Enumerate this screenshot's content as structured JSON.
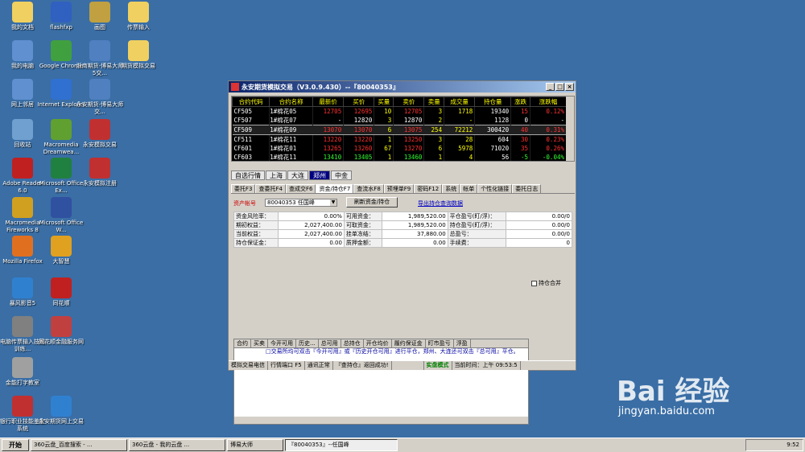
{
  "desktop": {
    "icons": [
      {
        "label": "我的文档",
        "icon": "documents-icon",
        "color": "#f0d060"
      },
      {
        "label": "flashfxp",
        "icon": "flashfxp-icon",
        "color": "#3060c0"
      },
      {
        "label": "画图",
        "icon": "paint-icon",
        "color": "#c0a040"
      },
      {
        "label": "传票输入",
        "icon": "folder-icon",
        "color": "#f0d060"
      },
      {
        "label": "我的电脑",
        "icon": "computer-icon",
        "color": "#6090d0"
      },
      {
        "label": "Google Chrome",
        "icon": "chrome-icon",
        "color": "#40a040"
      },
      {
        "label": "浙商期货-博易大师5交...",
        "icon": "shortcut-icon",
        "color": "#5080c0"
      },
      {
        "label": "期货模拟交易",
        "icon": "folder-icon",
        "color": "#f0d060"
      },
      {
        "label": "网上邻居",
        "icon": "network-icon",
        "color": "#6090d0"
      },
      {
        "label": "Internet Explorer",
        "icon": "ie-icon",
        "color": "#3070d0"
      },
      {
        "label": "永安期货-博易大师交...",
        "icon": "shortcut-icon",
        "color": "#5080c0"
      },
      {
        "label": "回收站",
        "icon": "recycle-bin-icon",
        "color": "#70a0d0"
      },
      {
        "label": "Macromedia Dreamwea...",
        "icon": "dreamweaver-icon",
        "color": "#60a030"
      },
      {
        "label": "永安模拟交易",
        "icon": "trade-icon",
        "color": "#c03030"
      },
      {
        "label": "Adobe Reader 6.0",
        "icon": "adobe-reader-icon",
        "color": "#c02020"
      },
      {
        "label": "Microsoft Office Ex...",
        "icon": "excel-icon",
        "color": "#208040"
      },
      {
        "label": "永安模拟注册",
        "icon": "trade-icon",
        "color": "#c03030"
      },
      {
        "label": "Macromedia Fireworks 8",
        "icon": "fireworks-icon",
        "color": "#d0a020"
      },
      {
        "label": "Microsoft Office W...",
        "icon": "word-icon",
        "color": "#3050a0"
      },
      {
        "label": "Mozilla Firefox",
        "icon": "firefox-icon",
        "color": "#e07020"
      },
      {
        "label": "大智慧",
        "icon": "dzh-icon",
        "color": "#e0a020"
      },
      {
        "label": "暴风影音5",
        "icon": "player-icon",
        "color": "#3080d0"
      },
      {
        "label": "同花顺",
        "icon": "ths-icon",
        "color": "#c02020"
      },
      {
        "label": "电脑传票输入技能训练...",
        "icon": "training-icon",
        "color": "#808080"
      },
      {
        "label": "同花顺金融服务网",
        "icon": "news-icon",
        "color": "#c04040"
      },
      {
        "label": "金能打字教室",
        "icon": "typing-icon",
        "color": "#a0a0a0"
      },
      {
        "label": "银行职业技能鉴定系统",
        "icon": "bank-icon",
        "color": "#c03030"
      },
      {
        "label": "永安期货网上交易",
        "icon": "trade-online-icon",
        "color": "#3080d0"
      }
    ]
  },
  "window": {
    "title": "永安期货模拟交易（V3.0.9.430）--『80040353』",
    "quote_headers": [
      "合约代码",
      "合约名称",
      "最新价",
      "买价",
      "买量",
      "卖价",
      "卖量",
      "成交量",
      "持仓量",
      "涨跌",
      "涨跌幅"
    ],
    "quote_rows": [
      [
        "CF505",
        "1#棉花05",
        "12705",
        "12695",
        "10",
        "12705",
        "3",
        "1718",
        "19340",
        "15",
        "0.12%"
      ],
      [
        "CF507",
        "1#棉花07",
        "-",
        "12820",
        "3",
        "12870",
        "2",
        "-",
        "1128",
        "0",
        "-"
      ],
      [
        "CF509",
        "1#棉花09",
        "13070",
        "13070",
        "6",
        "13075",
        "254",
        "72212",
        "300420",
        "40",
        "0.31%"
      ],
      [
        "CF511",
        "1#棉花11",
        "13220",
        "13220",
        "1",
        "13250",
        "3",
        "28",
        "604",
        "30",
        "0.23%"
      ],
      [
        "CF601",
        "1#棉花01",
        "13265",
        "13260",
        "67",
        "13270",
        "6",
        "5978",
        "71020",
        "35",
        "0.26%"
      ],
      [
        "CF603",
        "1#棉花11",
        "13410",
        "13405",
        "1",
        "13460",
        "1",
        "4",
        "56",
        "-5",
        "-0.04%"
      ]
    ],
    "market_tabs": [
      "自选行情",
      "上海",
      "大连",
      "郑州",
      "中金"
    ],
    "active_market": "郑州",
    "sub_tabs": [
      "委托F3",
      "查委托F4",
      "查成交F6",
      "资金/持仓F7",
      "查流水F8",
      "预埋单F9",
      "密码F12",
      "系统",
      "帐单",
      "个性化链接",
      "委托日志"
    ],
    "active_sub": "资金/持仓F7",
    "account_label": "资产帐号",
    "account_value": "80040353 任国峰",
    "refresh_button": "刷新资金/持仓",
    "export_link": "导出持仓查询数据",
    "fund": [
      [
        "资金风险率：",
        "0.00%",
        "可用资金：",
        "1,989,520.00",
        "平仓盈亏(盯/浮)：",
        "0.00/0"
      ],
      [
        "期初权益：",
        "2,027,400.00",
        "可取资金：",
        "1,989,520.00",
        "持仓盈亏(盯/浮)：",
        "0.00/0"
      ],
      [
        "当前权益：",
        "2,027,400.00",
        "挂单冻结：",
        "37,880.00",
        "总盈亏：",
        "0.00/0"
      ],
      [
        "持仓保证金：",
        "0.00",
        "质押金额：",
        "0.00",
        "手续费：",
        "0"
      ]
    ],
    "position_headers": [
      "合约",
      "买卖",
      "今开可用",
      "历史...",
      "总可用",
      "总持仓",
      "开仓均价",
      "履约保证金",
      "盯市盈亏",
      "浮盈"
    ],
    "merge_checkbox": "持仓合并",
    "tip": "□交易所均可双击『今开可用』或『历史开仓可用』进行平仓，郑州、大连还可双击『总可用』平仓。",
    "status": [
      "模拟交易电信",
      "行情端口 F5",
      "通讯正常",
      "『查持仓』返回成功!",
      "",
      "实盘模式",
      "当前时间：上午 09:53:5"
    ]
  },
  "taskbar": {
    "start": "开始",
    "tasks": [
      "360云盘_百度搜索 - ...",
      "360云盘 - 我的云盘 ...",
      "博易大师",
      "『80040353』--任国峰"
    ],
    "time": "9:52"
  },
  "watermark": {
    "brand": "Bai 经验",
    "url": "jingyan.baidu.com"
  }
}
